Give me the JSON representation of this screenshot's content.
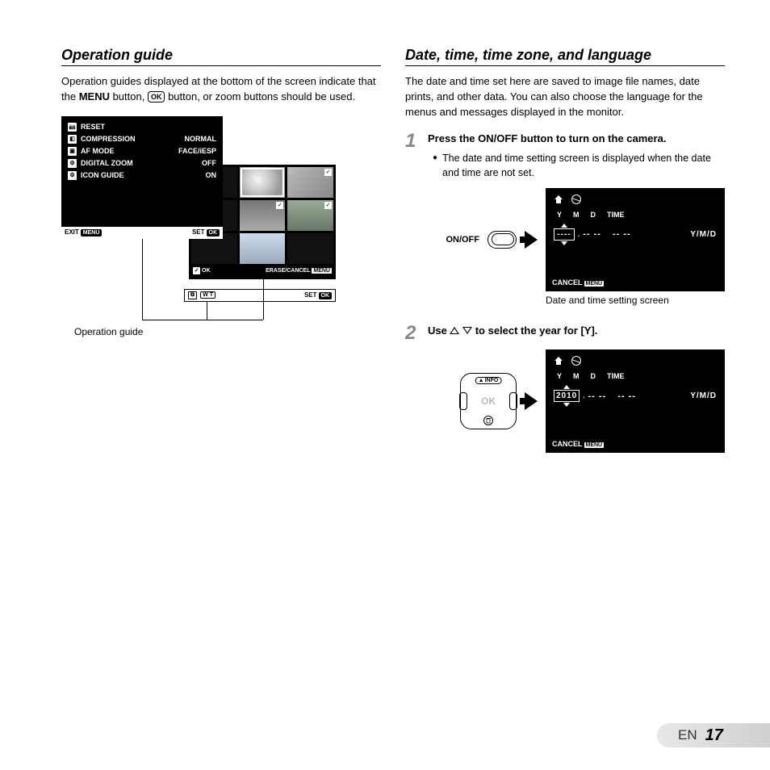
{
  "left": {
    "title": "Operation guide",
    "intro_1": "Operation guides displayed at the bottom of the screen indicate that the ",
    "intro_menu": "MENU",
    "intro_2": " button, ",
    "intro_ok": "OK",
    "intro_3": " button, or zoom buttons should be used.",
    "menu": {
      "rows": [
        {
          "icon": "📷",
          "label": "RESET",
          "val": ""
        },
        {
          "icon": "◧",
          "label": "COMPRESSION",
          "val": "NORMAL"
        },
        {
          "icon": "▣",
          "label": "AF MODE",
          "val": "FACE/iESP"
        },
        {
          "icon": "⚙",
          "label": "DIGITAL ZOOM",
          "val": "OFF"
        },
        {
          "icon": "⚙",
          "label": "ICON GUIDE",
          "val": "ON"
        }
      ],
      "exit": "EXIT",
      "exit_chip": "MENU",
      "set": "SET",
      "set_chip": "OK"
    },
    "zoom": {
      "icon": "⧉",
      "wt": "W T",
      "set": "SET",
      "set_chip": "OK"
    },
    "thumb": {
      "ok": "OK",
      "erase": "ERASE/CANCEL",
      "erase_chip": "MENU"
    },
    "caption": "Operation guide"
  },
  "right": {
    "title": "Date, time, time zone, and language",
    "intro": "The date and time set here are saved to image file names, date prints, and other data. You can also choose the language for the menus and messages displayed in the monitor.",
    "step1": {
      "num": "1",
      "head_1": "Press the ",
      "onoff": "ON/OFF",
      "head_2": " button to turn on the camera.",
      "bullet": "The date and time setting screen is displayed when the date and time are not set.",
      "onoff_label": "ON/OFF",
      "caption": "Date and time setting screen"
    },
    "ds": {
      "y": "Y",
      "m": "M",
      "d": "D",
      "time": "TIME",
      "year": "----",
      "month": "-- --",
      "daytime": "-- --",
      "ymd": "Y/M/D",
      "cancel": "CANCEL",
      "cancel_chip": "MENU"
    },
    "step2": {
      "num": "2",
      "head_1": "Use ",
      "head_2": " to select the year for [Y].",
      "info": "INFO",
      "ok": "OK",
      "year": "2010"
    }
  },
  "footer": {
    "lang": "EN",
    "page": "17"
  }
}
